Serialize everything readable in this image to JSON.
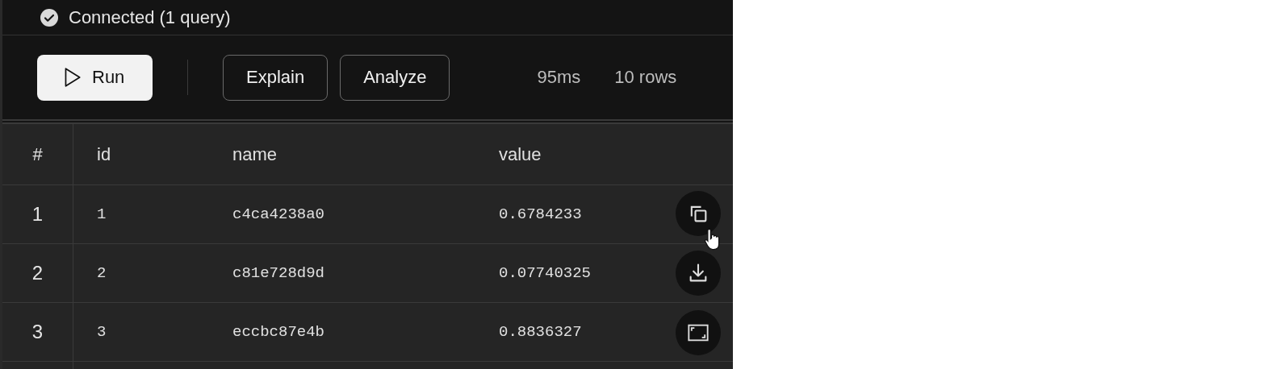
{
  "status": {
    "text": "Connected (1 query)",
    "connected": true
  },
  "toolbar": {
    "buttons": [
      {
        "kind": "primary",
        "label": "Run"
      },
      {
        "kind": "secondary",
        "label": "Explain"
      },
      {
        "kind": "secondary",
        "label": "Analyze"
      }
    ],
    "stats": [
      "95ms",
      "10 rows"
    ]
  },
  "table": {
    "columns": [
      "#",
      "id",
      "name",
      "value"
    ],
    "rows": [
      {
        "cells": [
          "1",
          "1",
          "c4ca4238a0",
          "0.6784233"
        ]
      },
      {
        "cells": [
          "2",
          "2",
          "c81e728d9d",
          "0.07740325"
        ]
      },
      {
        "cells": [
          "3",
          "3",
          "eccbc87e4b",
          "0.8836327"
        ]
      }
    ]
  },
  "floating_actions": [
    {
      "kind": "copy"
    },
    {
      "kind": "download"
    },
    {
      "kind": "expand"
    }
  ]
}
